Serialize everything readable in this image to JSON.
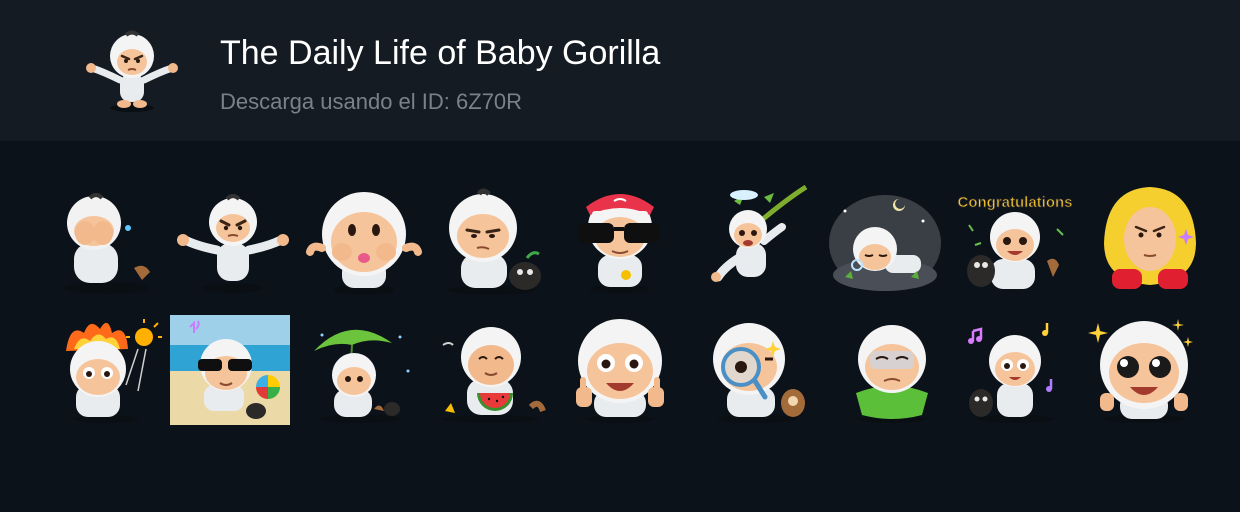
{
  "pack": {
    "title": "The Daily Life of Baby Gorilla",
    "download_text": "Descarga usando el ID: 6Z70R",
    "icon": "baby-gorilla-sticker-icon"
  },
  "stickers": [
    {
      "name": "sticker-covering-face",
      "icon": "baby-gorilla-covering-face"
    },
    {
      "name": "sticker-angry",
      "icon": "baby-gorilla-angry"
    },
    {
      "name": "sticker-kiss",
      "icon": "baby-gorilla-kiss"
    },
    {
      "name": "sticker-unamused",
      "icon": "baby-gorilla-unamused"
    },
    {
      "name": "sticker-sunglasses-cap",
      "icon": "baby-gorilla-sunglasses-cap"
    },
    {
      "name": "sticker-swinging-branch",
      "icon": "baby-gorilla-swinging"
    },
    {
      "name": "sticker-sleeping",
      "icon": "baby-gorilla-sleeping"
    },
    {
      "name": "sticker-congratulations",
      "icon": "baby-gorilla-congratulations",
      "text": "Congratulations"
    },
    {
      "name": "sticker-yellow-hood",
      "icon": "baby-gorilla-yellow-hood"
    },
    {
      "name": "sticker-on-fire",
      "icon": "baby-gorilla-on-fire"
    },
    {
      "name": "sticker-beach",
      "icon": "baby-gorilla-beach"
    },
    {
      "name": "sticker-leaf-umbrella",
      "icon": "baby-gorilla-leaf-umbrella"
    },
    {
      "name": "sticker-watermelon",
      "icon": "baby-gorilla-watermelon"
    },
    {
      "name": "sticker-thumbs-up",
      "icon": "baby-gorilla-thumbs-up"
    },
    {
      "name": "sticker-magnifier",
      "icon": "baby-gorilla-magnifier"
    },
    {
      "name": "sticker-sad-green",
      "icon": "baby-gorilla-sad"
    },
    {
      "name": "sticker-music",
      "icon": "baby-gorilla-music"
    },
    {
      "name": "sticker-sparkle-eyes",
      "icon": "baby-gorilla-sparkle-eyes"
    }
  ],
  "colors": {
    "header_bg": "#141b23",
    "page_bg": "#0c121a",
    "title": "#ffffff",
    "subtitle": "#7b8189"
  }
}
